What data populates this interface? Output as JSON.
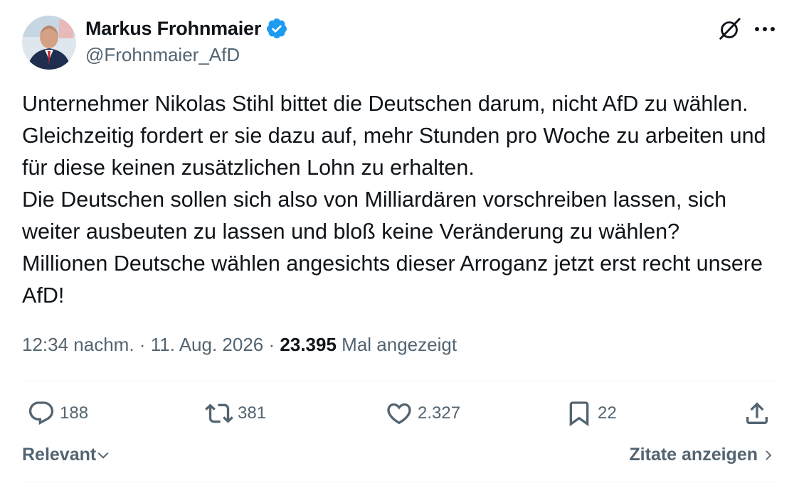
{
  "author": {
    "display_name": "Markus Frohnmaier",
    "handle": "@Frohnmaier_AfD",
    "verified": true,
    "verified_color": "#1d9bf0"
  },
  "tweet": {
    "paragraphs": [
      "Unternehmer Nikolas Stihl bittet die Deutschen darum, nicht AfD zu wählen. Gleichzeitig fordert er sie dazu auf, mehr Stunden pro Woche zu arbeiten und für diese keinen zusätzlichen Lohn zu erhalten.",
      "Die Deutschen sollen sich also von Milliardären vorschreiben lassen, sich weiter ausbeuten zu lassen und bloß keine Veränderung zu wählen?",
      "Millionen Deutsche wählen angesichts dieser Arroganz jetzt erst recht unsere AfD!"
    ],
    "time": "12:34 nachm.",
    "date": "11. Aug. 2026",
    "separator": "·",
    "views": "23.395",
    "views_label": "Mal angezeigt"
  },
  "actions": {
    "replies": "188",
    "reposts": "381",
    "likes": "2.327",
    "bookmarks": "22"
  },
  "footer": {
    "sort_label": "Relevant",
    "quotes_label": "Zitate anzeigen"
  },
  "icons": [
    "verified-badge-icon",
    "grok-icon",
    "more-icon",
    "reply-icon",
    "repost-icon",
    "like-icon",
    "bookmark-icon",
    "share-icon",
    "chevron-down-icon",
    "chevron-right-icon"
  ],
  "colors": {
    "text_primary": "#0f1419",
    "text_secondary": "#536471",
    "divider": "#eff3f4",
    "accent": "#1d9bf0"
  }
}
